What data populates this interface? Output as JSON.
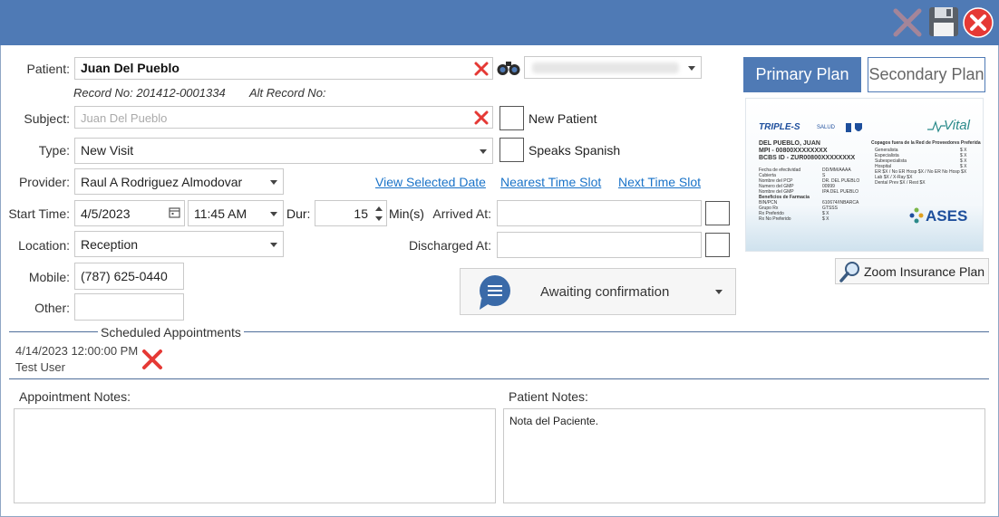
{
  "form": {
    "patient_label": "Patient:",
    "patient_value": "Juan Del Pueblo",
    "record_no": "Record No: 201412-0001334",
    "alt_record_no": "Alt Record No:",
    "subject_label": "Subject:",
    "subject_placeholder": "Juan Del Pueblo",
    "new_patient_label": "New Patient",
    "speaks_spanish_label": "Speaks Spanish",
    "type_label": "Type:",
    "type_value": "New Visit",
    "provider_label": "Provider:",
    "provider_value": "Raul A Rodriguez Almodovar",
    "view_selected_date": "View Selected Date",
    "nearest_time_slot": "Nearest Time Slot",
    "next_time_slot": "Next Time Slot",
    "start_time_label": "Start Time:",
    "start_date": "4/5/2023",
    "start_time": "11:45 AM",
    "dur_label": "Dur:",
    "dur_value": "15",
    "mins_label": "Min(s)",
    "arrived_label": "Arrived At:",
    "discharged_label": "Discharged At:",
    "location_label": "Location:",
    "location_value": "Reception",
    "mobile_label": "Mobile:",
    "mobile_value": "(787) 625-0440",
    "other_label": "Other:",
    "status_label": "Awaiting confirmation"
  },
  "plans": {
    "primary": "Primary Plan",
    "secondary": "Secondary Plan",
    "zoom": "Zoom Insurance Plan"
  },
  "card": {
    "brand": "TRIPLE-S",
    "brand_sub": "SALUD",
    "name": "DEL PUEBLO, JUAN",
    "mpi": "MPI - 00800XXXXXXXX",
    "bcbs": "BCBS ID - ZUR00800XXXXXXXX",
    "vital": "Vital",
    "ases": "ASES",
    "left_rows": [
      [
        "Fecha de efectividad",
        "DD/MM/AAAA"
      ],
      [
        "Cubierta",
        "S"
      ],
      [
        "Nombre del PCP",
        "DR. DEL PUEBLO"
      ],
      [
        "Numero del GMP",
        "00999"
      ],
      [
        "Nombre del GMP",
        "IPA DEL PUEBLO"
      ],
      [
        "Beneficios de Farmacia",
        ""
      ],
      [
        "BIN/PCN",
        "610674/INBARCA"
      ],
      [
        "Grupo Rx",
        "GTSSS"
      ],
      [
        "Rx Preferido",
        "$ X"
      ],
      [
        "Rx No Preferido",
        "$ X"
      ]
    ],
    "right_title": "Copagos fuera de la Red de Proveedores Preferida",
    "right_rows": [
      [
        "Generalista",
        "$ X"
      ],
      [
        "Especialista",
        "$ X"
      ],
      [
        "Subespecialista",
        "$ X"
      ],
      [
        "Hospital",
        "$ X"
      ],
      [
        "ER $X / No ER Hosp $X / No ER No Hosp $X",
        ""
      ],
      [
        "Lab $X / X-Ray $X",
        ""
      ],
      [
        "Dental Prev $X / Rest $X",
        ""
      ]
    ]
  },
  "scheduled": {
    "title": "Scheduled Appointments",
    "items": [
      {
        "datetime": "4/14/2023 12:00:00 PM",
        "user": "Test User"
      }
    ]
  },
  "notes": {
    "appointment_label": "Appointment Notes:",
    "appointment_value": "",
    "patient_label": "Patient Notes:",
    "patient_value": "Nota del Paciente."
  },
  "colors": {
    "accent": "#4f7ab5",
    "link": "#1a73c8",
    "delete_red": "#e53935"
  }
}
